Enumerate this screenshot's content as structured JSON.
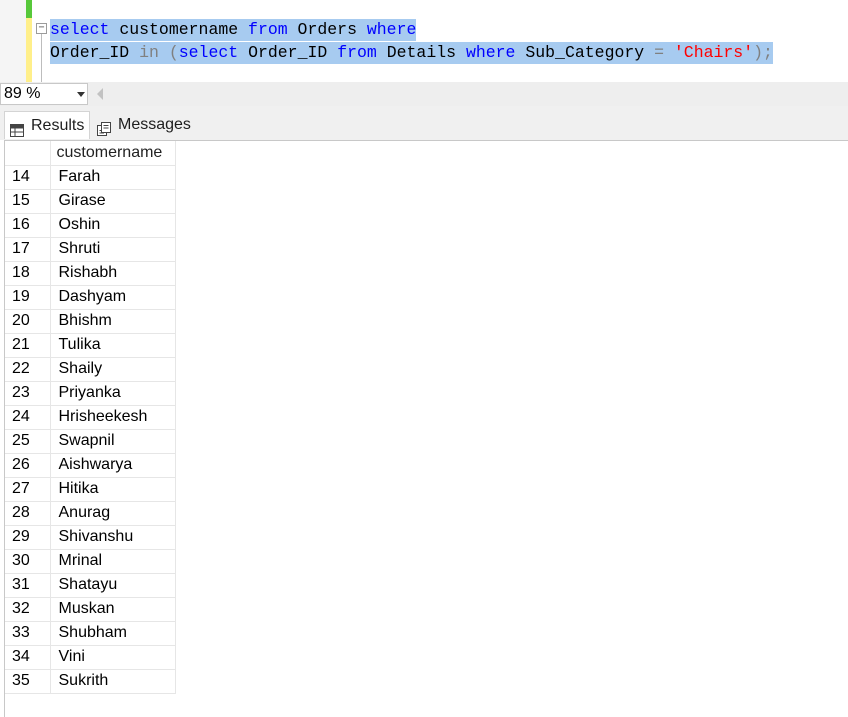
{
  "editor": {
    "line1": [
      {
        "t": "select",
        "c": "kw"
      },
      {
        "t": " customername ",
        "c": "id"
      },
      {
        "t": "from",
        "c": "kw"
      },
      {
        "t": " Orders ",
        "c": "id"
      },
      {
        "t": "where",
        "c": "kw"
      }
    ],
    "line2": [
      {
        "t": "Order_ID ",
        "c": "id"
      },
      {
        "t": "in",
        "c": "op"
      },
      {
        "t": " (",
        "c": "op"
      },
      {
        "t": "select",
        "c": "kw"
      },
      {
        "t": " Order_ID ",
        "c": "id"
      },
      {
        "t": "from",
        "c": "kw"
      },
      {
        "t": " Details ",
        "c": "id"
      },
      {
        "t": "where",
        "c": "kw"
      },
      {
        "t": " Sub_Category ",
        "c": "id"
      },
      {
        "t": "=",
        "c": "op"
      },
      {
        "t": " ",
        "c": "id"
      },
      {
        "t": "'Chairs'",
        "c": "str"
      },
      {
        "t": ");",
        "c": "op"
      }
    ],
    "collapse_glyph": "−"
  },
  "zoom": {
    "value": "89 %"
  },
  "tabs": {
    "results_label": "Results",
    "messages_label": "Messages"
  },
  "results": {
    "column_header": "customername",
    "rows": [
      {
        "num": "14",
        "name": "Farah"
      },
      {
        "num": "15",
        "name": "Girase"
      },
      {
        "num": "16",
        "name": "Oshin"
      },
      {
        "num": "17",
        "name": "Shruti"
      },
      {
        "num": "18",
        "name": "Rishabh"
      },
      {
        "num": "19",
        "name": "Dashyam"
      },
      {
        "num": "20",
        "name": "Bhishm"
      },
      {
        "num": "21",
        "name": "Tulika"
      },
      {
        "num": "22",
        "name": "Shaily"
      },
      {
        "num": "23",
        "name": "Priyanka"
      },
      {
        "num": "24",
        "name": "Hrisheekesh"
      },
      {
        "num": "25",
        "name": "Swapnil"
      },
      {
        "num": "26",
        "name": "Aishwarya"
      },
      {
        "num": "27",
        "name": "Hitika"
      },
      {
        "num": "28",
        "name": "Anurag"
      },
      {
        "num": "29",
        "name": "Shivanshu"
      },
      {
        "num": "30",
        "name": "Mrinal"
      },
      {
        "num": "31",
        "name": "Shatayu"
      },
      {
        "num": "32",
        "name": "Muskan"
      },
      {
        "num": "33",
        "name": "Shubham"
      },
      {
        "num": "34",
        "name": "Vini"
      },
      {
        "num": "35",
        "name": "Sukrith"
      }
    ]
  },
  "colors": {
    "keyword": "#0000ff",
    "string": "#ff0000",
    "operator": "#808080",
    "selection": "#a7cbf0"
  }
}
